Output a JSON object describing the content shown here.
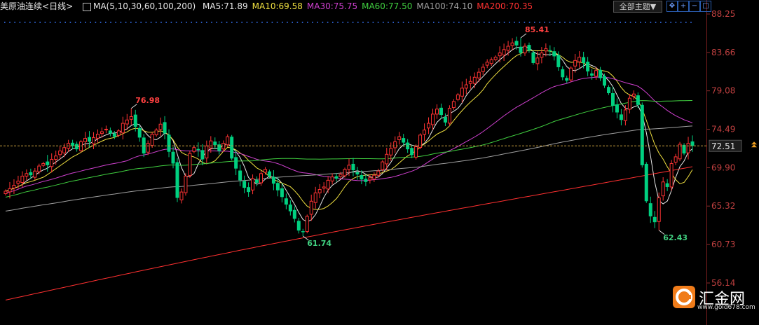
{
  "header": {
    "title": "美原油连续",
    "period": "<日线>",
    "ma_label": "MA(5,10,30,60,100,200)",
    "ma": [
      {
        "text": "MA5:71.89",
        "color": "#e8e8e8"
      },
      {
        "text": "MA10:69.58",
        "color": "#f0e040"
      },
      {
        "text": "MA30:75.75",
        "color": "#d040d0"
      },
      {
        "text": "MA60:77.50",
        "color": "#40d040"
      },
      {
        "text": "MA100:74.10",
        "color": "#a0a0a0"
      },
      {
        "text": "MA200:70.35",
        "color": "#ff3030"
      }
    ],
    "dropdown_label": "全部主题▼",
    "icons": [
      "expand-icon",
      "zoom-in-icon",
      "zoom-out-icon",
      "restore-icon"
    ]
  },
  "colors": {
    "up": "#ff3333",
    "down": "#00d080",
    "axis_text": "#c04040",
    "last_price_bg": "#1c1c1c"
  },
  "chart_data": {
    "type": "candlestick",
    "y_ticks": [
      "88.25",
      "83.66",
      "79.08",
      "74.49",
      "69.90",
      "65.32",
      "60.73",
      "56.14"
    ],
    "ylim": [
      56.14,
      88.25
    ],
    "last_price": "72.51",
    "annotations": [
      {
        "label": "76.98",
        "index": 30,
        "kind": "high",
        "color": "#ff4040"
      },
      {
        "label": "61.74",
        "index": 71,
        "kind": "low",
        "color": "#40d080"
      },
      {
        "label": "85.41",
        "index": 123,
        "kind": "high",
        "color": "#ff4040"
      },
      {
        "label": "62.43",
        "index": 156,
        "kind": "low",
        "color": "#40d080"
      }
    ],
    "close": [
      67.1,
      67.4,
      67.8,
      68.3,
      68.9,
      69.2,
      69.0,
      69.5,
      70.1,
      70.4,
      70.2,
      70.9,
      71.3,
      71.9,
      72.3,
      72.8,
      72.5,
      72.1,
      73.0,
      73.4,
      73.0,
      73.5,
      73.9,
      74.2,
      74.5,
      74.0,
      73.6,
      74.3,
      75.2,
      75.6,
      76.0,
      74.8,
      73.5,
      71.6,
      72.8,
      73.9,
      74.4,
      75.1,
      74.0,
      71.8,
      70.4,
      66.3,
      67.0,
      68.9,
      71.6,
      72.3,
      72.0,
      70.9,
      72.5,
      73.1,
      72.6,
      71.9,
      72.8,
      73.6,
      71.0,
      69.8,
      68.4,
      67.5,
      67.0,
      68.6,
      68.1,
      69.2,
      69.7,
      68.9,
      68.0,
      67.2,
      66.4,
      65.5,
      64.7,
      63.8,
      62.4,
      62.2,
      64.1,
      65.9,
      66.9,
      67.3,
      67.6,
      68.4,
      68.8,
      68.6,
      69.1,
      69.7,
      70.2,
      69.6,
      69.1,
      68.5,
      68.2,
      68.7,
      69.0,
      69.5,
      70.6,
      71.5,
      72.2,
      73.0,
      73.6,
      72.9,
      72.1,
      71.4,
      72.4,
      73.8,
      74.4,
      75.2,
      76.3,
      76.9,
      76.2,
      75.3,
      77.0,
      77.8,
      78.6,
      79.4,
      79.8,
      80.2,
      80.7,
      81.3,
      81.9,
      82.5,
      82.8,
      83.1,
      83.6,
      84.0,
      84.4,
      84.8,
      84.5,
      83.6,
      84.4,
      83.9,
      82.4,
      83.0,
      83.6,
      84.1,
      83.8,
      83.2,
      81.9,
      80.7,
      80.3,
      81.8,
      82.7,
      83.1,
      82.4,
      81.4,
      80.9,
      81.5,
      80.6,
      79.7,
      78.8,
      77.3,
      76.5,
      75.6,
      76.8,
      78.2,
      78.7,
      77.4,
      70.2,
      65.9,
      64.1,
      63.4,
      66.3,
      68.2,
      67.6,
      70.4,
      71.2,
      72.7,
      71.6,
      72.8,
      72.5
    ],
    "ma_series": [
      {
        "name": "MA5",
        "color": "#e8e8e8",
        "period": 5
      },
      {
        "name": "MA10",
        "color": "#f0e040",
        "period": 10
      },
      {
        "name": "MA30",
        "color": "#d040d0",
        "period": 30
      },
      {
        "name": "MA60",
        "color": "#40d040",
        "period": 60
      },
      {
        "name": "MA100",
        "color": "#a0a0a0",
        "period": 100
      },
      {
        "name": "MA200",
        "color": "#ff3030",
        "period": 200
      }
    ],
    "ma_start": {
      "MA30": 66.2,
      "MA60": 65.8,
      "MA100": 64.2,
      "MA200": 54.1
    },
    "ma_end": {
      "MA30": 76.0,
      "MA60": 77.5,
      "MA100": 74.1,
      "MA200": 70.35
    }
  },
  "brand": {
    "name": "汇金网",
    "url": "www.gold678.com"
  }
}
